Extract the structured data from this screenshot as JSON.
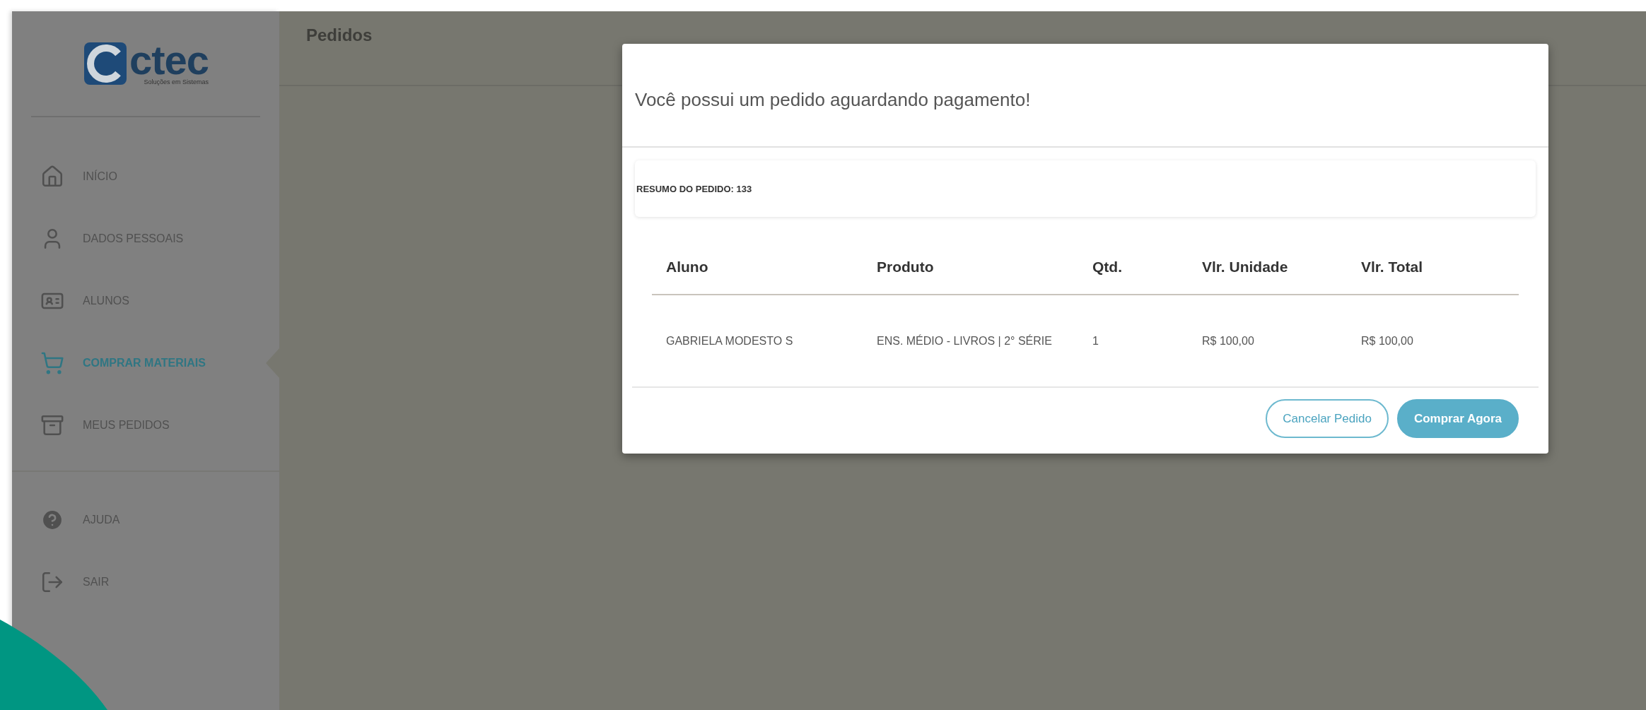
{
  "logo": {
    "text": "ctec",
    "tagline": "Soluções em Sistemas"
  },
  "sidebar": {
    "groups": [
      {
        "items": [
          {
            "label": "INÍCIO",
            "selected": false
          },
          {
            "label": "DADOS PESSOAIS",
            "selected": false
          },
          {
            "label": "ALUNOS",
            "selected": false
          },
          {
            "label": "COMPRAR MATERIAIS",
            "selected": true
          },
          {
            "label": "MEUS PEDIDOS",
            "selected": false
          }
        ]
      },
      {
        "items": [
          {
            "label": "AJUDA",
            "selected": false
          },
          {
            "label": "SAIR",
            "selected": false
          }
        ]
      }
    ]
  },
  "page": {
    "title": "Pedidos"
  },
  "modal": {
    "title": "Você possui um pedido aguardando pagamento!",
    "summary": "RESUMO DO PEDIDO: 133",
    "table": {
      "columns": [
        "Aluno",
        "Produto",
        "Qtd.",
        "Vlr. Unidade",
        "Vlr. Total"
      ],
      "rows": [
        [
          "GABRIELA MODESTO S",
          "ENS. MÉDIO - LIVROS | 2° SÉRIE",
          "1",
          "R$ 100,00",
          "R$ 100,00"
        ]
      ]
    },
    "buttons": [
      {
        "label": "Cancelar Pedido",
        "kind": "outline"
      },
      {
        "label": "Comprar Agora",
        "kind": "primary"
      }
    ]
  }
}
